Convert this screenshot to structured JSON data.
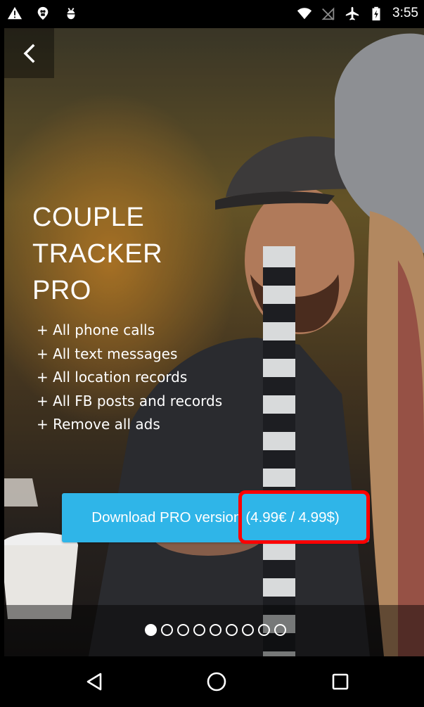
{
  "status_bar": {
    "time": "3:55",
    "left_icons": [
      "warning-icon",
      "location-pin-icon",
      "android-debug-icon"
    ],
    "right_icons": [
      "wifi-icon",
      "no-sim-icon",
      "airplane-mode-icon",
      "battery-charging-icon"
    ]
  },
  "top_bar": {
    "back_icon": "chevron-left-icon"
  },
  "promo": {
    "title": "COUPLE\nTRACKER\nPRO",
    "features": [
      "+ All phone calls",
      "+ All text messages",
      "+ All location records",
      "+ All FB posts and records",
      "+ Remove all ads"
    ]
  },
  "download_button": {
    "label": "Download PRO version",
    "price": "(4.99€ / 4.99$)",
    "color": "#2fb5e8",
    "highlight_color": "#ff0000"
  },
  "page_indicator": {
    "total": 9,
    "active_index": 0
  },
  "nav_bar": {
    "icons": [
      "back-triangle-icon",
      "home-circle-icon",
      "recents-square-icon"
    ]
  }
}
